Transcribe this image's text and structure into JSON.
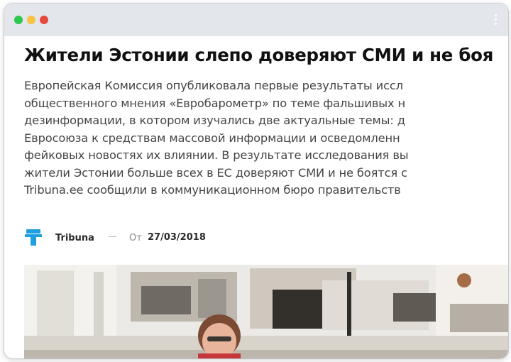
{
  "window": {
    "controls": [
      "close",
      "minimize",
      "maximize"
    ],
    "menu_icon": "more-vertical-icon",
    "colors": {
      "titlebar": "#e3e6eb",
      "green": "#2fc74f",
      "yellow": "#f6c343",
      "red": "#e64a3f"
    }
  },
  "article": {
    "headline": "Жители Эстонии слепо доверяют СМИ и не боя",
    "lede_lines": [
      "Европейская Комиссия опубликовала первые результаты иссл",
      "общественного мнения «Евробарометр» по теме фальшивых н",
      "дезинформации, в котором изучались две актуальные темы: д",
      "Евросоюза к средствам массовой информации и осведомленн",
      "фейковых новостях их влиянии. В результате исследования вы",
      "жители Эстонии больше всех в ЕС доверяют СМИ и не боятся с",
      "Tribuna.ee сообщили в коммуникационном бюро правительств"
    ],
    "byline": {
      "logo_icon": "tribuna-logo-icon",
      "author": "Tribuna",
      "separator": "—",
      "date_prefix": "От",
      "date": "27/03/2018"
    },
    "image": {
      "alt_description": "office-photo"
    }
  }
}
